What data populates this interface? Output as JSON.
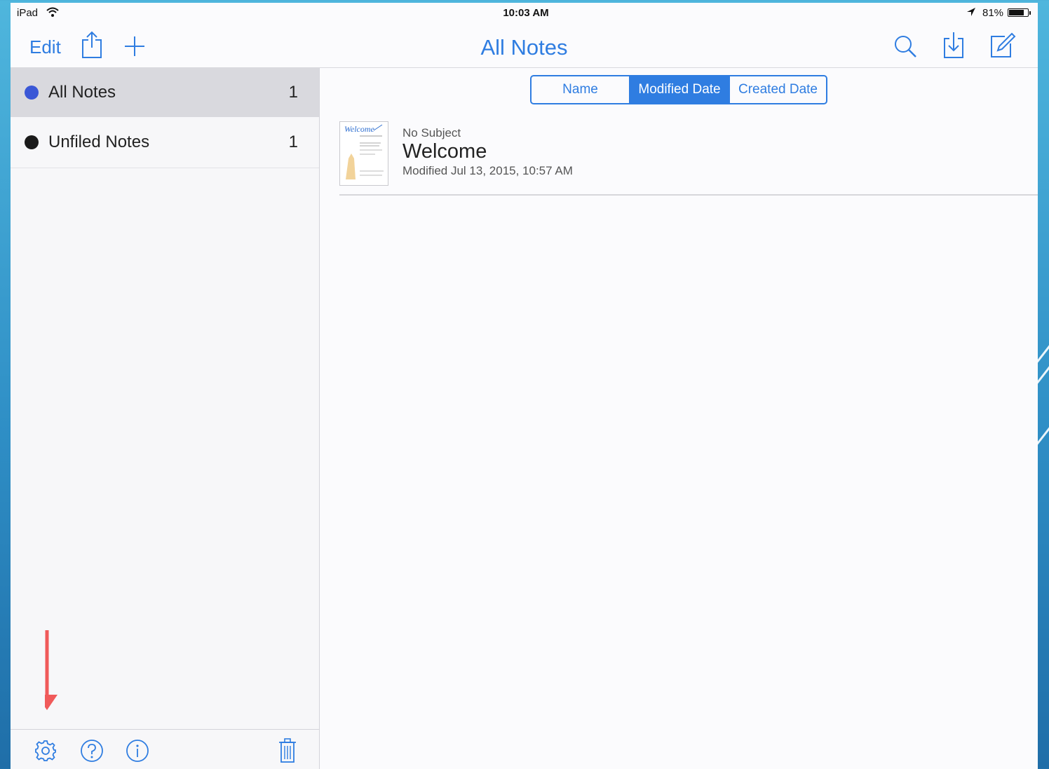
{
  "theme": {
    "accent": "#2f7de1",
    "annotation": "#f05a5a",
    "dot_all": "#3a57d6",
    "dot_unfiled": "#1a1a1a"
  },
  "statusbar": {
    "carrier": "iPad",
    "time": "10:03 AM",
    "battery": "81%",
    "battery_level": 0.81
  },
  "nav": {
    "edit_label": "Edit",
    "title": "All Notes"
  },
  "sidebar": {
    "items": [
      {
        "label": "All Notes",
        "count": "1"
      },
      {
        "label": "Unfiled Notes",
        "count": "1"
      }
    ]
  },
  "sort": {
    "options": [
      "Name",
      "Modified Date",
      "Created Date"
    ],
    "selected": "Modified Date"
  },
  "notes": [
    {
      "subject": "No Subject",
      "title": "Welcome",
      "meta": "Modified Jul 13, 2015, 10:57 AM",
      "thumb_text": "Welcome"
    }
  ],
  "icons": {
    "nav_left": [
      "share-icon",
      "plus-icon"
    ],
    "nav_right": [
      "search-icon",
      "import-icon",
      "compose-icon"
    ],
    "toolbar": [
      "gear-icon",
      "help-icon",
      "info-icon",
      "trash-icon"
    ]
  }
}
